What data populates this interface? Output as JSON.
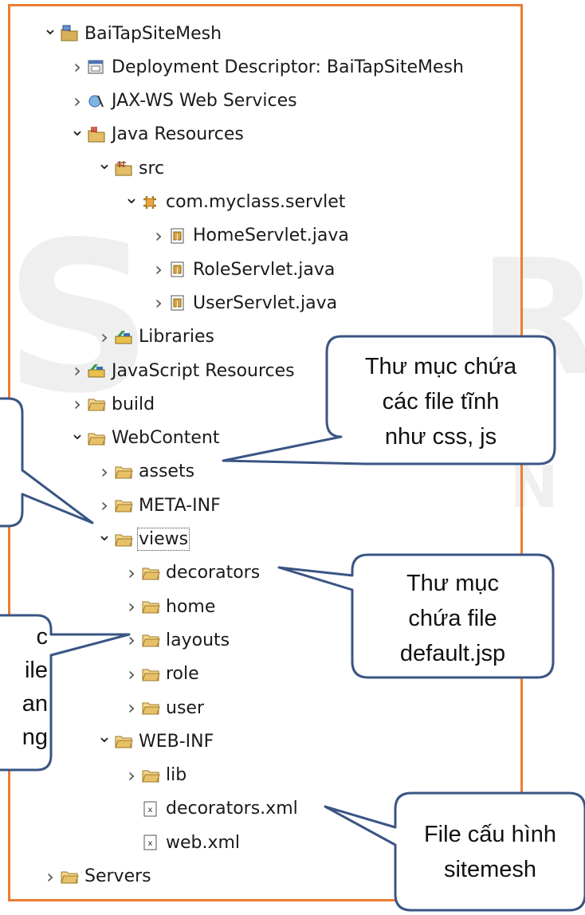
{
  "tree": [
    {
      "label": "BaiTapSiteMesh",
      "icon": "project-icon",
      "state": "open",
      "level": 0
    },
    {
      "label": "Deployment Descriptor: BaiTapSiteMesh",
      "icon": "deployment-descriptor-icon",
      "state": "closed",
      "level": 1
    },
    {
      "label": "JAX-WS Web Services",
      "icon": "web-services-icon",
      "state": "closed",
      "level": 1
    },
    {
      "label": "Java Resources",
      "icon": "java-resources-icon",
      "state": "open",
      "level": 1
    },
    {
      "label": "src",
      "icon": "source-folder-icon",
      "state": "open",
      "level": 2
    },
    {
      "label": "com.myclass.servlet",
      "icon": "package-icon",
      "state": "open",
      "level": 3
    },
    {
      "label": "HomeServlet.java",
      "icon": "java-file-icon",
      "state": "closed",
      "level": 4
    },
    {
      "label": "RoleServlet.java",
      "icon": "java-file-icon",
      "state": "closed",
      "level": 4
    },
    {
      "label": "UserServlet.java",
      "icon": "java-file-icon",
      "state": "closed",
      "level": 4
    },
    {
      "label": "Libraries",
      "icon": "libraries-icon",
      "state": "closed",
      "level": 2
    },
    {
      "label": "JavaScript Resources",
      "icon": "libraries-icon",
      "state": "closed",
      "level": 1
    },
    {
      "label": "build",
      "icon": "folder-icon",
      "state": "closed",
      "level": 1
    },
    {
      "label": "WebContent",
      "icon": "folder-icon",
      "state": "open",
      "level": 1
    },
    {
      "label": "assets",
      "icon": "folder-icon",
      "state": "closed",
      "level": 2
    },
    {
      "label": "META-INF",
      "icon": "folder-icon",
      "state": "closed",
      "level": 2
    },
    {
      "label": "views",
      "icon": "folder-icon",
      "state": "open",
      "level": 2,
      "selected": true
    },
    {
      "label": "decorators",
      "icon": "folder-icon",
      "state": "closed",
      "level": 3
    },
    {
      "label": "home",
      "icon": "folder-icon",
      "state": "closed",
      "level": 3
    },
    {
      "label": "layouts",
      "icon": "folder-icon",
      "state": "closed",
      "level": 3
    },
    {
      "label": "role",
      "icon": "folder-icon",
      "state": "closed",
      "level": 3
    },
    {
      "label": "user",
      "icon": "folder-icon",
      "state": "closed",
      "level": 3
    },
    {
      "label": "WEB-INF",
      "icon": "folder-icon",
      "state": "open",
      "level": 2
    },
    {
      "label": "lib",
      "icon": "folder-icon",
      "state": "closed",
      "level": 3
    },
    {
      "label": "decorators.xml",
      "icon": "xml-file-icon",
      "state": "none",
      "level": 3
    },
    {
      "label": "web.xml",
      "icon": "xml-file-icon",
      "state": "none",
      "level": 3
    },
    {
      "label": "Servers",
      "icon": "folder-icon",
      "state": "closed",
      "level": 0
    }
  ],
  "callouts": {
    "static_files": [
      "Thư mục chứa",
      "các file tĩnh",
      "như css, js"
    ],
    "decorators": [
      "Thư mục",
      "chứa file",
      "default.jsp"
    ],
    "layouts_partial": [
      "c",
      "ile",
      "an",
      "ng"
    ],
    "sitemesh_config": [
      "File cấu hình",
      "sitemesh"
    ]
  },
  "colors": {
    "panel_border": "#ed7d31",
    "callout_border": "#3a5584",
    "folder": "#d9b05a"
  }
}
